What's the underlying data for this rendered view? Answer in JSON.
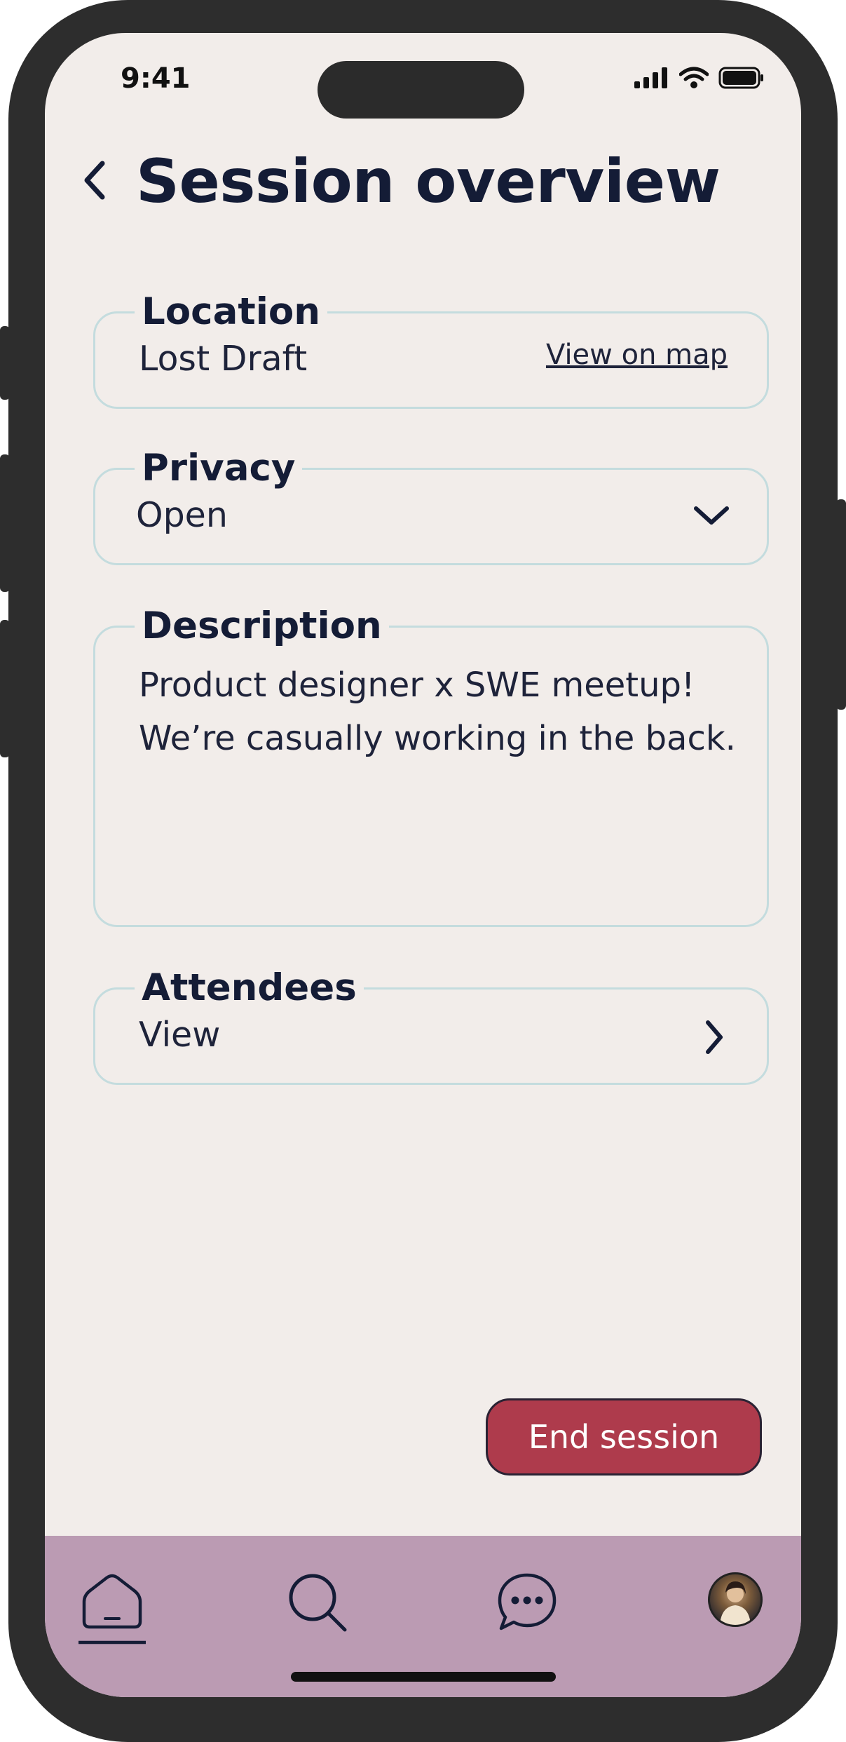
{
  "status_bar": {
    "time": "9:41"
  },
  "header": {
    "title": "Session overview"
  },
  "location": {
    "label": "Location",
    "value": "Lost Draft",
    "map_link": "View on map"
  },
  "privacy": {
    "label": "Privacy",
    "value": "Open"
  },
  "description": {
    "label": "Description",
    "text": "Product designer x SWE meetup! We’re casually working in the back."
  },
  "attendees": {
    "label": "Attendees",
    "value": "View"
  },
  "actions": {
    "end_session": "End session"
  },
  "colors": {
    "background": "#f2edea",
    "title": "#141c36",
    "field_border": "#c4dcde",
    "danger": "#ae3b4c",
    "tab_bar": "#bb9bb3",
    "device_frame": "#2d2d2d"
  },
  "tab_bar": {
    "items": [
      {
        "icon": "home-icon",
        "active": true
      },
      {
        "icon": "search-icon",
        "active": false
      },
      {
        "icon": "chat-icon",
        "active": false
      },
      {
        "icon": "avatar",
        "active": false
      }
    ]
  }
}
